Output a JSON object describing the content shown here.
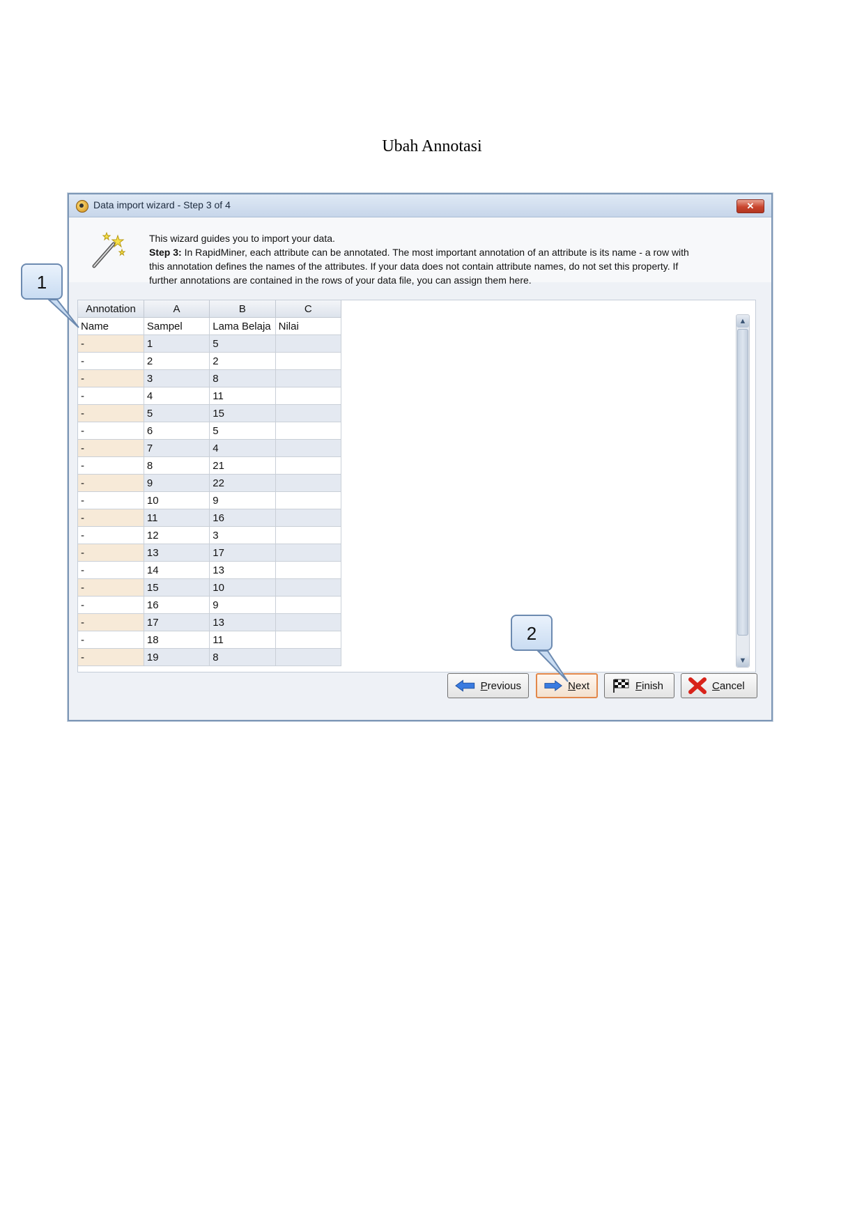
{
  "page": {
    "title": "Ubah Annotasi"
  },
  "window": {
    "title": "Data import wizard - Step 3 of 4",
    "close_label": "✕",
    "icon": "rapidminer-app-icon"
  },
  "intro": {
    "line1": "This wizard guides you to import your data.",
    "step_label": "Step 3:",
    "line2": " In RapidMiner, each attribute can be annotated. The most important annotation of an attribute is its name - a row with",
    "line3": "this annotation defines the names of the attributes. If your data does not contain attribute names, do not set this property. If",
    "line4": "further annotations are contained in the rows of your data file, you can assign them here."
  },
  "table": {
    "headers": [
      "Annotation",
      "A",
      "B",
      "C"
    ],
    "name_row": [
      "Name",
      "Sampel",
      "Lama Belaja",
      "Nilai"
    ],
    "rows": [
      [
        "-",
        "1",
        "5",
        ""
      ],
      [
        "-",
        "2",
        "2",
        ""
      ],
      [
        "-",
        "3",
        "8",
        ""
      ],
      [
        "-",
        "4",
        "11",
        ""
      ],
      [
        "-",
        "5",
        "15",
        ""
      ],
      [
        "-",
        "6",
        "5",
        ""
      ],
      [
        "-",
        "7",
        "4",
        ""
      ],
      [
        "-",
        "8",
        "21",
        ""
      ],
      [
        "-",
        "9",
        "22",
        ""
      ],
      [
        "-",
        "10",
        "9",
        ""
      ],
      [
        "-",
        "11",
        "16",
        ""
      ],
      [
        "-",
        "12",
        "3",
        ""
      ],
      [
        "-",
        "13",
        "17",
        ""
      ],
      [
        "-",
        "14",
        "13",
        ""
      ],
      [
        "-",
        "15",
        "10",
        ""
      ],
      [
        "-",
        "16",
        "9",
        ""
      ],
      [
        "-",
        "17",
        "13",
        ""
      ],
      [
        "-",
        "18",
        "11",
        ""
      ],
      [
        "-",
        "19",
        "8",
        ""
      ]
    ]
  },
  "buttons": {
    "previous": "Previous",
    "next": "Next",
    "finish": "Finish",
    "cancel": "Cancel"
  },
  "callouts": {
    "one": "1",
    "two": "2"
  },
  "colors": {
    "accent": "#e2874a",
    "title_bar": "#c7d6ea",
    "callout": "#c9dcf2"
  }
}
